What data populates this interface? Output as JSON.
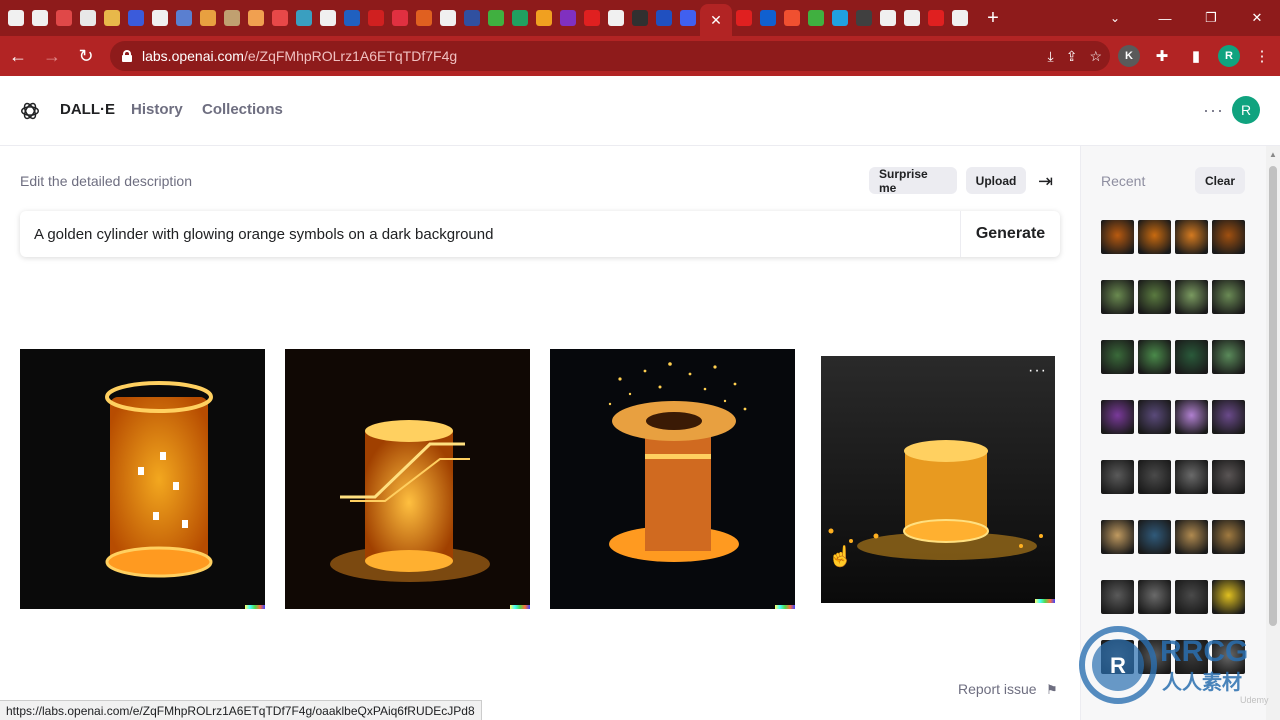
{
  "browser": {
    "favicons": [
      "#f0f0f0",
      "#f0f0f0",
      "#e04848",
      "#e8e8e8",
      "#e8b84a",
      "#3b5bdb",
      "#f0f0f0",
      "#5a7fd0",
      "#e8a040",
      "#c0a070",
      "#f0a050",
      "#e84848",
      "#3a9fc0",
      "#f0f0f0",
      "#2060c0",
      "#d02020",
      "#e03040",
      "#e06020",
      "#f0f0f0",
      "#3050a0",
      "#40b040",
      "#20a060",
      "#f0a020",
      "#8030c0",
      "#e02020",
      "#f0f0f0",
      "#303030",
      "#2050c0",
      "#4060f0"
    ],
    "favicons_after": [
      "#e02020",
      "#1060d0",
      "#f05030",
      "#40b040",
      "#20a0e0",
      "#404040",
      "#f0f0f0",
      "#f0f0f0",
      "#e02020",
      "#f0f0f0"
    ],
    "close_tab_glyph": "✕",
    "new_tab_glyph": "+",
    "url_host": "labs.openai.com",
    "url_path": "/e/ZqFMhpROLrz1A6ETqTDf7F4g",
    "profile_k": "K",
    "profile_r": "R",
    "status_url": "https://labs.openai.com/e/ZqFMhpROLrz1A6ETqTDf7F4g/oaaklbeQxPAiq6fRUDEcJPd8"
  },
  "app": {
    "brand": "DALL·E",
    "nav": [
      "History",
      "Collections"
    ],
    "avatar_letter": "R",
    "edit_label": "Edit the detailed description",
    "surprise_label": "Surprise me",
    "upload_label": "Upload",
    "prompt": "A golden cylinder with glowing orange symbols on a dark background",
    "generate_label": "Generate",
    "report_label": "Report issue",
    "accent": "#10a37f"
  },
  "results": [
    {
      "name": "result-1",
      "desc": "glowing orange cylinder with symbols"
    },
    {
      "name": "result-2",
      "desc": "golden cylinder with lightning"
    },
    {
      "name": "result-3",
      "desc": "golden spool with sparkles"
    },
    {
      "name": "result-4",
      "desc": "golden cylinder on dark surface"
    }
  ],
  "sidebar": {
    "recent_label": "Recent",
    "clear_label": "Clear",
    "thumb_rows": [
      [
        "#b85a10",
        "#c86a10",
        "#d47a20",
        "#a05010"
      ],
      [
        "#6a8a50",
        "#5a7a40",
        "#7a9a60",
        "#6a8a55"
      ],
      [
        "#3a6a3a",
        "#4a8a4a",
        "#2a5a3a",
        "#5a8a5a"
      ],
      [
        "#7a3a9a",
        "#5a4a7a",
        "#b080d0",
        "#6a4a8a"
      ],
      [
        "#5a5a5a",
        "#4a4a4a",
        "#6a6a6a",
        "#5a5555"
      ],
      [
        "#c09a60",
        "#305a7a",
        "#b08a50",
        "#a07a40"
      ],
      [
        "#5a5a5a",
        "#6a6a6a",
        "#4a4a4a",
        "#e0c020"
      ],
      [
        "#4a4a4a",
        "#5a5a5a",
        "#3a3a3a",
        "#6a6a6a"
      ]
    ]
  },
  "watermark": {
    "text": "RRCG",
    "subtext": "人人素材",
    "corner": "Udemy"
  }
}
